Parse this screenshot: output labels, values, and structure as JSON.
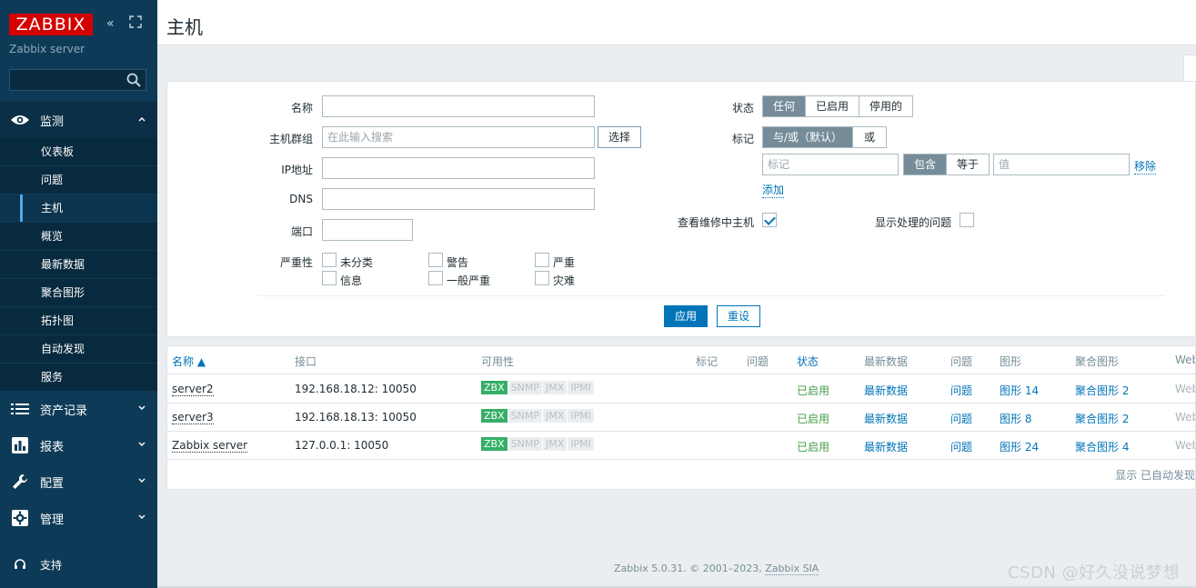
{
  "sidebar": {
    "logo": "ZABBIX",
    "server_name": "Zabbix server",
    "search_value": "",
    "sections": {
      "monitoring": "监测",
      "inventory": "资产记录",
      "reports": "报表",
      "configuration": "配置",
      "administration": "管理",
      "support": "支持"
    },
    "monitoring_items": [
      {
        "label": "仪表板"
      },
      {
        "label": "问题"
      },
      {
        "label": "主机"
      },
      {
        "label": "概览"
      },
      {
        "label": "最新数据"
      },
      {
        "label": "聚合图形"
      },
      {
        "label": "拓扑图"
      },
      {
        "label": "自动发现"
      },
      {
        "label": "服务"
      }
    ],
    "active_item": "主机"
  },
  "header": {
    "title": "主机"
  },
  "filter": {
    "name_label": "名称",
    "name_value": "",
    "hostgroup_label": "主机群组",
    "hostgroup_placeholder": "在此输入搜索",
    "select_button": "选择",
    "ip_label": "IP地址",
    "dns_label": "DNS",
    "port_label": "端口",
    "severity_label": "严重性",
    "severities": [
      "未分类",
      "警告",
      "严重",
      "信息",
      "一般严重",
      "灾难"
    ],
    "status_label": "状态",
    "status_options": [
      "任何",
      "已启用",
      "停用的"
    ],
    "status_selected": "任何",
    "tags_label": "标记",
    "tags_operator_options": [
      "与/或（默认）",
      "或"
    ],
    "tag_placeholder": "标记",
    "tag_match_options": [
      "包含",
      "等于"
    ],
    "value_placeholder": "值",
    "remove_link": "移除",
    "add_link": "添加",
    "maintenance_label": "查看维修中主机",
    "maintenance_checked": true,
    "suppressed_label": "显示处理的问题",
    "suppressed_checked": false,
    "apply_button": "应用",
    "reset_button": "重设"
  },
  "table": {
    "columns": [
      "名称 ▲",
      "接口",
      "可用性",
      "标记",
      "问题",
      "状态",
      "最新数据",
      "问题",
      "图形",
      "聚合图形",
      "Web"
    ],
    "rows": [
      {
        "name": "server2",
        "interface": "192.168.18.12: 10050",
        "availability": [
          "ZBX",
          "SNMP",
          "JMX",
          "IPMI"
        ],
        "status": "已启用",
        "latest": "最新数据",
        "problems": "问题",
        "graphs": "图形 14",
        "screens": "聚合图形 2",
        "web": "Web"
      },
      {
        "name": "server3",
        "interface": "192.168.18.13: 10050",
        "availability": [
          "ZBX",
          "SNMP",
          "JMX",
          "IPMI"
        ],
        "status": "已启用",
        "latest": "最新数据",
        "problems": "问题",
        "graphs": "图形 8",
        "screens": "聚合图形 2",
        "web": "Web"
      },
      {
        "name": "Zabbix server",
        "interface": "127.0.0.1: 10050",
        "availability": [
          "ZBX",
          "SNMP",
          "JMX",
          "IPMI"
        ],
        "status": "已启用",
        "latest": "最新数据",
        "problems": "问题",
        "graphs": "图形 24",
        "screens": "聚合图形 4",
        "web": "Web"
      }
    ],
    "footer": "显示 已自动发现"
  },
  "footer": {
    "copyright": "Zabbix 5.0.31. © 2001–2023, ",
    "company": "Zabbix SIA"
  },
  "watermark": "CSDN @好久没说梦想",
  "colors": {
    "sidebar": "#0d3b57",
    "brand": "#d40000",
    "accent": "#0275b8",
    "enabled": "#429e47",
    "zbx_available": "#34af67"
  }
}
